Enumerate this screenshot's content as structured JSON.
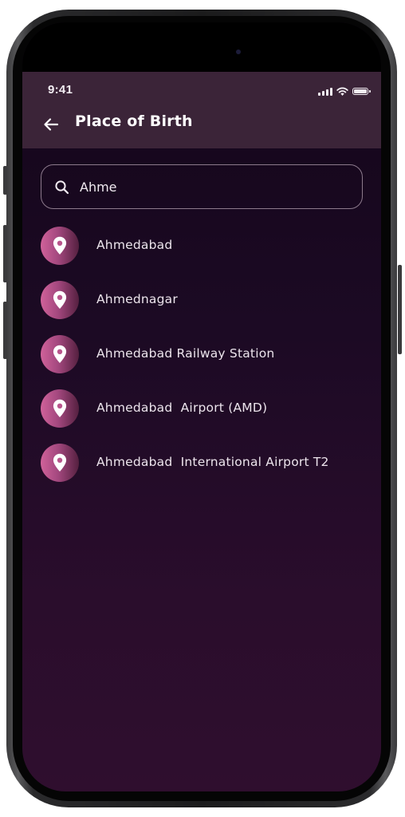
{
  "status_bar": {
    "time": "9:41",
    "icons": [
      "cellular-signal-icon",
      "wifi-icon",
      "battery-icon"
    ]
  },
  "header": {
    "back_icon": "arrow-left-icon",
    "title": "Place of Birth"
  },
  "search": {
    "icon": "search-icon",
    "value": "Ahme"
  },
  "results": [
    {
      "icon": "location-pin-icon",
      "label": "Ahmedabad"
    },
    {
      "icon": "location-pin-icon",
      "label": "Ahmednagar"
    },
    {
      "icon": "location-pin-icon",
      "label": "Ahmedabad Railway Station"
    },
    {
      "icon": "location-pin-icon",
      "label": "Ahmedabad  Airport (AMD)"
    },
    {
      "icon": "location-pin-icon",
      "label": "Ahmedabad  International Airport T2"
    }
  ],
  "colors": {
    "header_background": "#3b2438",
    "screen_background_top": "#130519",
    "screen_background_bottom": "#2f0e2e",
    "pin_accent": "#d0629a",
    "text_primary": "#ffffff"
  }
}
